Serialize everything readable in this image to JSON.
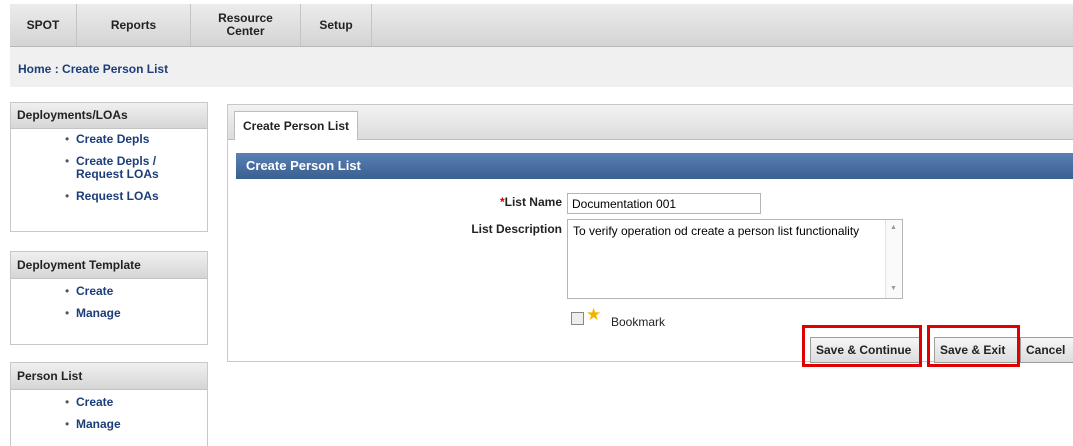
{
  "topnav": {
    "tabs": [
      {
        "label": "SPOT"
      },
      {
        "label": "Reports"
      },
      {
        "label": "Resource Center"
      },
      {
        "label": "Setup"
      }
    ]
  },
  "breadcrumb": {
    "home": "Home",
    "separator": ":",
    "current": "Create Person List"
  },
  "sidebar": {
    "deployments": {
      "title": "Deployments/LOAs",
      "items": [
        "Create Depls",
        "Create Depls / Request LOAs",
        "Request LOAs"
      ]
    },
    "template": {
      "title": "Deployment Template",
      "items": [
        "Create",
        "Manage"
      ]
    },
    "personlist": {
      "title": "Person List",
      "items": [
        "Create",
        "Manage"
      ]
    }
  },
  "main": {
    "tab_label": "Create Person List",
    "section_title": "Create Person List",
    "form": {
      "required_mark": "*",
      "list_name_label": "List Name",
      "list_name_value": "Documentation 001",
      "list_description_label": "List Description",
      "list_description_value": "To verify operation od create a person list functionality",
      "bookmark_label": "Bookmark",
      "bookmark_checked": false
    },
    "buttons": {
      "save_continue": "Save & Continue",
      "save_exit": "Save & Exit",
      "cancel": "Cancel"
    }
  },
  "colors": {
    "section_header": "#3a5f91",
    "link": "#1c3d7a",
    "highlight": "#e00000"
  }
}
